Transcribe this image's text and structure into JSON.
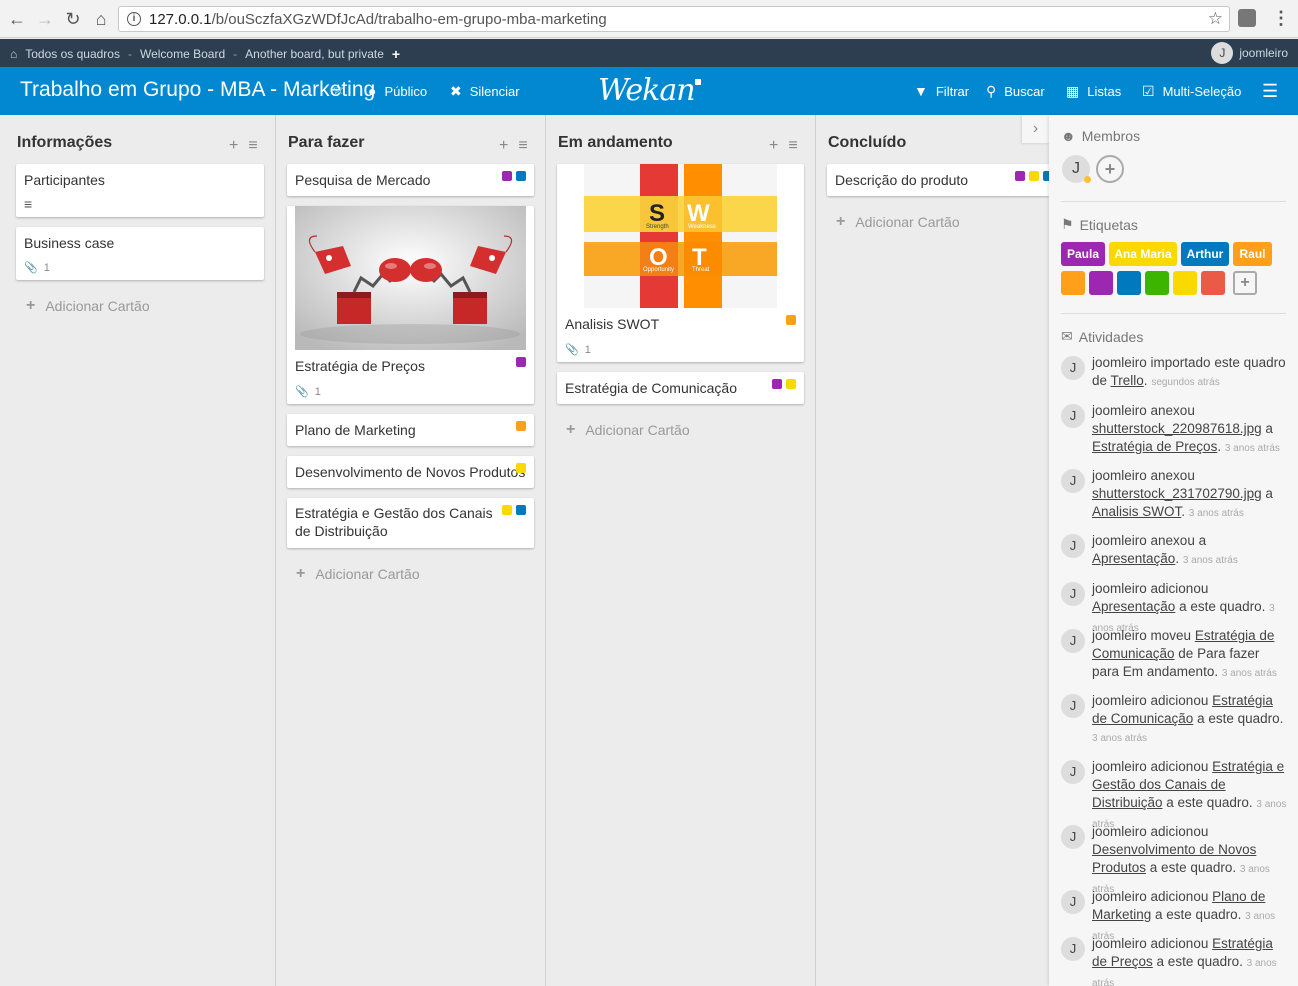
{
  "browser": {
    "url_host": "127.0.0.1",
    "url_path": "/b/ouSczfaXGzWDfJcAd/trabalho-em-grupo-mba-marketing"
  },
  "topbar": {
    "breadcrumbs": [
      "Todos os quadros",
      "Welcome Board",
      "Another board, but private"
    ],
    "separator": "-",
    "user_initial": "J",
    "username": "joomleiro"
  },
  "header": {
    "title": "Trabalho em Grupo - MBA - Marketing",
    "visibility": "Público",
    "mute": "Silenciar",
    "logo": "Wekan",
    "filter": "Filtrar",
    "search": "Buscar",
    "lists": "Listas",
    "multiselect": "Multi-Seleção"
  },
  "colors": {
    "purple": "#9c27b0",
    "blue": "#0079bf",
    "orange": "#ff9f1a",
    "yellow": "#fad900",
    "green": "#3cb500",
    "red": "#eb5a46",
    "header_blue": "#0288d1"
  },
  "lists": [
    {
      "title": "Informações",
      "add_card": "Adicionar Cartão",
      "cards": [
        {
          "title": "Participantes",
          "description_icon": "description-icon"
        },
        {
          "title": "Business case",
          "attachments": "1"
        }
      ]
    },
    {
      "title": "Para fazer",
      "add_card": "Adicionar Cartão",
      "cards": [
        {
          "title": "Pesquisa de Mercado",
          "labels": [
            "purple",
            "blue"
          ]
        },
        {
          "title": "Estratégia de Preços",
          "labels": [
            "purple"
          ],
          "attachments": "1",
          "cover": "boxing-gloves-image"
        },
        {
          "title": "Plano de Marketing",
          "labels": [
            "orange"
          ]
        },
        {
          "title": "Desenvolvimento de Novos Produtos",
          "labels": [
            "yellow"
          ]
        },
        {
          "title": "Estratégia e Gestão dos Canais de Distribuição",
          "labels": [
            "yellow",
            "blue"
          ]
        }
      ]
    },
    {
      "title": "Em andamento",
      "add_card": "Adicionar Cartão",
      "cards": [
        {
          "title": "Analisis SWOT",
          "labels": [
            "orange"
          ],
          "attachments": "1",
          "cover": "swot-image"
        },
        {
          "title": "Estratégia de Comunicação",
          "labels": [
            "purple",
            "yellow"
          ]
        }
      ]
    },
    {
      "title": "Concluído",
      "add_card": "Adicionar Cartão",
      "cards": [
        {
          "title": "Descrição do produto",
          "labels": [
            "purple",
            "yellow",
            "blue"
          ]
        }
      ]
    }
  ],
  "swot": {
    "letters": [
      "S",
      "W",
      "O",
      "T"
    ],
    "words": [
      "Strength",
      "Weakness",
      "Opportunity",
      "Threat"
    ]
  },
  "sidebar": {
    "members_title": "Membros",
    "member_initial": "J",
    "labels_title": "Etiquetas",
    "named_labels": [
      {
        "name": "Paula",
        "color": "#9c27b0"
      },
      {
        "name": "Ana Maria",
        "color": "#fad900"
      },
      {
        "name": "Arthur",
        "color": "#0079bf"
      },
      {
        "name": "Raul",
        "color": "#ff9f1a"
      }
    ],
    "color_labels": [
      "#ff9f1a",
      "#9c27b0",
      "#0079bf",
      "#3cb500",
      "#fad900",
      "#eb5a46"
    ],
    "activities_title": "Atividades",
    "activities": [
      {
        "user": "joomleiro",
        "parts": [
          " importado este quadro de ",
          {
            "link": "Trello"
          },
          ". "
        ],
        "time": "segundos atrás"
      },
      {
        "user": "joomleiro",
        "parts": [
          " anexou ",
          {
            "link": "shutterstock_220987618.jpg"
          },
          " a ",
          {
            "link": "Estratégia de Preços"
          },
          ". "
        ],
        "time": "3 anos atrás"
      },
      {
        "user": "joomleiro",
        "parts": [
          " anexou ",
          {
            "link": "shutterstock_231702790.jpg"
          },
          " a ",
          {
            "link": "Analisis SWOT"
          },
          ". "
        ],
        "time": "3 anos atrás"
      },
      {
        "user": "joomleiro",
        "parts": [
          " anexou a ",
          {
            "link": "Apresentação"
          },
          ". "
        ],
        "time": "3 anos atrás"
      },
      {
        "user": "joomleiro",
        "parts": [
          " adicionou ",
          {
            "link": "Apresentação"
          },
          " a este quadro. "
        ],
        "time": "3 anos atrás"
      },
      {
        "user": "joomleiro",
        "parts": [
          " moveu ",
          {
            "link": "Estratégia de Comunicação"
          },
          " de Para fazer para Em andamento. "
        ],
        "time": "3 anos atrás"
      },
      {
        "user": "joomleiro",
        "parts": [
          " adicionou ",
          {
            "link": "Estratégia de Comunicação"
          },
          " a este quadro. "
        ],
        "time": "3 anos atrás"
      },
      {
        "user": "joomleiro",
        "parts": [
          " adicionou ",
          {
            "link": "Estratégia e Gestão dos Canais de Distribuição"
          },
          " a este quadro. "
        ],
        "time": "3 anos atrás"
      },
      {
        "user": "joomleiro",
        "parts": [
          " adicionou ",
          {
            "link": "Desenvolvimento de Novos Produtos"
          },
          " a este quadro. "
        ],
        "time": "3 anos atrás"
      },
      {
        "user": "joomleiro",
        "parts": [
          " adicionou ",
          {
            "link": "Plano de Marketing"
          },
          " a este quadro. "
        ],
        "time": "3 anos atrás"
      },
      {
        "user": "joomleiro",
        "parts": [
          " adicionou ",
          {
            "link": "Estratégia de Preços"
          },
          " a este quadro. "
        ],
        "time": "3 anos atrás"
      }
    ]
  }
}
